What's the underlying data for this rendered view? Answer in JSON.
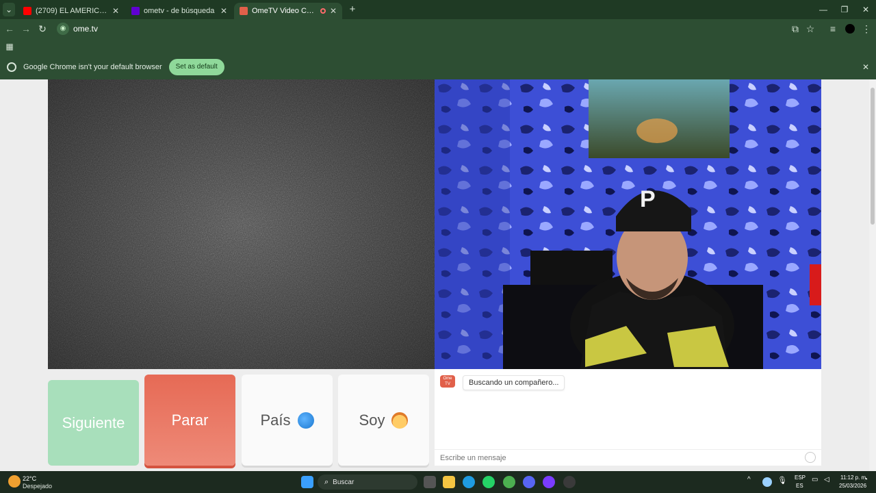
{
  "browser": {
    "tabs": [
      {
        "title": "(2709) EL AMERICANO 4KT - C",
        "favicon_color": "#ff0000",
        "active": false
      },
      {
        "title": "ometv - de búsqueda",
        "favicon_color": "#6001d2",
        "active": false
      },
      {
        "title": "OmeTV Video Chat — Ome",
        "favicon_color": "#e1604a",
        "active": true
      }
    ],
    "new_tab": "+",
    "url": "ome.tv",
    "infobar_text": "Google Chrome isn't your default browser",
    "set_default_label": "Set as default"
  },
  "ometv": {
    "next_label": "Siguiente",
    "stop_label": "Parar",
    "country_label": "País",
    "me_label": "Soy",
    "chat_logo_text": "Ome TV",
    "chat_status": "Buscando un compañero...",
    "chat_placeholder": "Escribe un mensaje",
    "stop_color": "#e66a55",
    "next_color": "#a8dfbb"
  },
  "taskbar": {
    "weather_temp": "22°C",
    "weather_desc": "Despejado",
    "search_label": "Buscar",
    "lang_a": "ESP",
    "lang_b": "ES",
    "time": "11:12 p. m.",
    "date": "25/03/2026"
  }
}
